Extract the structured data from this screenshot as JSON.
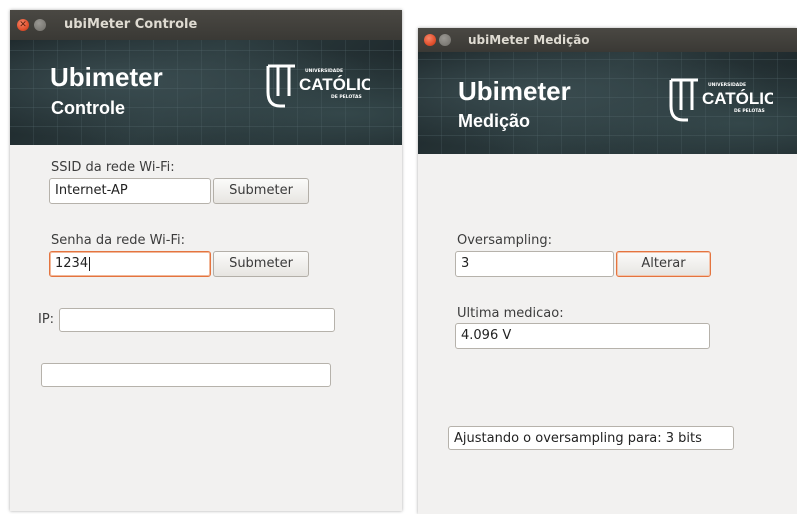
{
  "control_window": {
    "title": "ubiMeter Controle",
    "banner": {
      "title": "Ubimeter",
      "subtitle": "Controle",
      "logo": {
        "small_top": "UNIVERSIDADE",
        "main": "CATÓLICA",
        "small_bottom": "DE PELOTAS"
      }
    },
    "ssid": {
      "label": "SSID da rede Wi-Fi:",
      "value": "Internet-AP",
      "button": "Submeter"
    },
    "password": {
      "label": "Senha da rede Wi-Fi:",
      "value": "1234",
      "button": "Submeter"
    },
    "ip": {
      "label": "IP:",
      "value": ""
    },
    "extra_field": {
      "value": ""
    }
  },
  "measure_window": {
    "title": "ubiMeter Medição",
    "banner": {
      "title": "Ubimeter",
      "subtitle": "Medição",
      "logo": {
        "small_top": "UNIVERSIDADE",
        "main": "CATÓLICA",
        "small_bottom": "DE PELOTAS"
      }
    },
    "oversampling": {
      "label": "Oversampling:",
      "value": "3",
      "button": "Alterar"
    },
    "last_measure": {
      "label": "Ultima medicao:",
      "value": "4.096 V"
    },
    "status": "Ajustando o oversampling para: 3 bits"
  },
  "colors": {
    "titlebar": "#3c3b37",
    "focus_accent": "#e4743f",
    "window_bg": "#f2f1f0",
    "close_button": "#e2502d"
  },
  "icons": [
    "close-icon",
    "minimize-icon",
    "catolica-logo"
  ]
}
